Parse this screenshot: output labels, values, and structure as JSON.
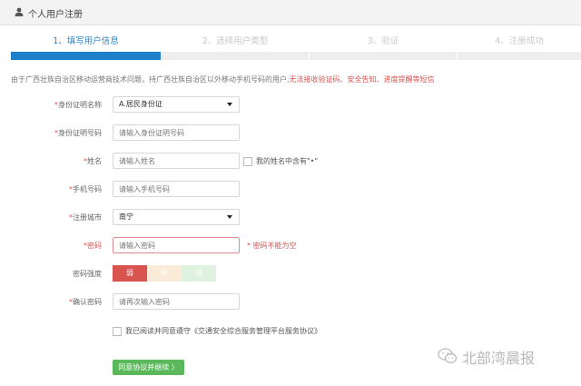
{
  "header": {
    "title": "个人用户注册",
    "icon": "user-icon"
  },
  "steps": [
    {
      "label": "1、填写用户信息",
      "active": true
    },
    {
      "label": "2、选择用户类型",
      "active": false
    },
    {
      "label": "3、验证",
      "active": false
    },
    {
      "label": "4、注册成功",
      "active": false
    }
  ],
  "notice": {
    "part1": "由于广西壮族自治区移动运营商技术问题，持广西壮族自治区以外移动手机号码的用户,",
    "part2": "无法接收验证码、安全告知、进度提醒等短信"
  },
  "form": {
    "id_type": {
      "label": "身份证明名称",
      "value": "A.居民身份证"
    },
    "id_number": {
      "label": "身份证明号码",
      "placeholder": "请输入身份证明号码"
    },
    "name": {
      "label": "姓名",
      "placeholder": "请输入姓名",
      "checkbox_label": "我的姓名中含有\"•\""
    },
    "phone": {
      "label": "手机号码",
      "placeholder": "请输入手机号码"
    },
    "city": {
      "label": "注册城市",
      "value": "南宁"
    },
    "password": {
      "label": "密码",
      "placeholder": "请输入密码",
      "error": "密码不能为空"
    },
    "strength": {
      "label": "密码强度",
      "levels": [
        "弱",
        "中",
        "强"
      ]
    },
    "confirm": {
      "label": "确认密码",
      "placeholder": "请再次输入密码"
    }
  },
  "agreement": {
    "text": "我已阅读并同意遵守《交通安全综合服务管理平台服务协议》"
  },
  "submit": {
    "label": "同意协议并继续 〉"
  },
  "watermark": {
    "text": "北部湾晨报",
    "icon": "wechat-icon"
  },
  "colors": {
    "primary": "#1e7fcb",
    "error": "#d9534f",
    "success": "#5cb85c"
  }
}
